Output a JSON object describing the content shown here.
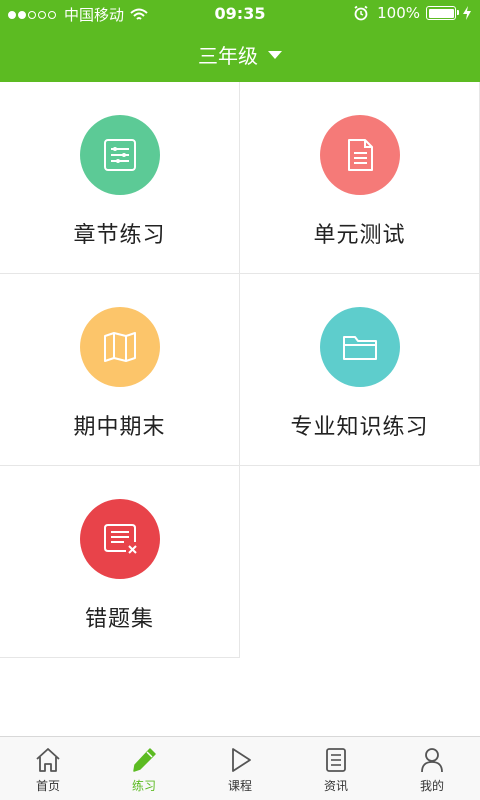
{
  "statusbar": {
    "carrier": "中国移动",
    "time": "09:35",
    "battery": "100%"
  },
  "header": {
    "grade": "三年级"
  },
  "colors": {
    "brand": "#5cbb22",
    "chapter": "#5cca96",
    "unit": "#f57a78",
    "midterm": "#fcc56a",
    "knowledge": "#5ecdcc",
    "mistakes": "#e8434a"
  },
  "grid": {
    "items": [
      {
        "label": "章节练习",
        "icon": "list-sliders-icon"
      },
      {
        "label": "单元测试",
        "icon": "document-icon"
      },
      {
        "label": "期中期末",
        "icon": "map-icon"
      },
      {
        "label": "专业知识练习",
        "icon": "folder-icon"
      },
      {
        "label": "错题集",
        "icon": "error-list-icon"
      }
    ]
  },
  "tabbar": {
    "tabs": [
      {
        "label": "首页",
        "icon": "home-icon"
      },
      {
        "label": "练习",
        "icon": "pencil-icon",
        "active": true
      },
      {
        "label": "课程",
        "icon": "play-icon"
      },
      {
        "label": "资讯",
        "icon": "news-icon"
      },
      {
        "label": "我的",
        "icon": "user-icon"
      }
    ]
  }
}
